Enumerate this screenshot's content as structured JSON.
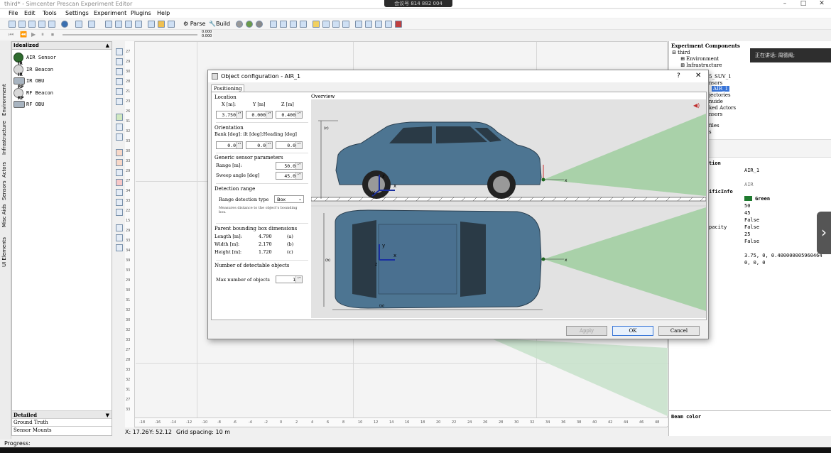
{
  "window": {
    "title": "third* - Simcenter Prescan Experiment Editor",
    "meeting_id": "会议号 814 882 004"
  },
  "menu": [
    "File",
    "Edit",
    "Tools",
    "Settings",
    "Experiment",
    "Plugins",
    "Help"
  ],
  "toolbar": {
    "parse_label": "Parse",
    "build_label": "Build",
    "val1": "0.000",
    "val2": "0.000"
  },
  "left_tabs": [
    "Environment",
    "Infrastructure",
    "Actors",
    "Sensors",
    "Misc Aids",
    "UI Elements"
  ],
  "left_panel": {
    "header": "Idealized",
    "items": [
      {
        "label": "AIR Sensor",
        "sup": ""
      },
      {
        "label": "IR Beacon",
        "sup": "IR"
      },
      {
        "label": "IR OBU",
        "sup": "IR"
      },
      {
        "label": "RF Beacon",
        "sup": "RF"
      },
      {
        "label": "RF OBU",
        "sup": "RF"
      }
    ],
    "bottom_header": "Detailed",
    "bottom_items": [
      "Ground Truth",
      "Sensor Mounts"
    ]
  },
  "canvas": {
    "left_ticks": [
      "27",
      "29",
      "30",
      "28",
      "21",
      "23",
      "26",
      "31",
      "32",
      "33",
      "30",
      "33",
      "29",
      "27",
      "34",
      "33",
      "22",
      "15",
      "29",
      "33",
      "34",
      "39",
      "33",
      "29",
      "30",
      "31",
      "32",
      "30",
      "32",
      "33",
      "27",
      "28",
      "33",
      "32",
      "31",
      "27",
      "33"
    ],
    "bottom_ticks": [
      "-18",
      "-16",
      "-14",
      "-12",
      "-10",
      "-8",
      "-6",
      "-4",
      "-2",
      "0",
      "2",
      "4",
      "6",
      "8",
      "10",
      "12",
      "14",
      "16",
      "18",
      "20",
      "22",
      "24",
      "26",
      "28",
      "30",
      "32",
      "34",
      "36",
      "38",
      "40",
      "42",
      "44",
      "46",
      "48"
    ],
    "status": {
      "x": "X: 17.26",
      "y": "Y: 52.12",
      "grid": "Grid spacing: 10 m"
    }
  },
  "progress_label": "Progress:",
  "right_panel": {
    "header": "Experiment Components",
    "tree": [
      "third",
      "Environment",
      "Infrastructure",
      "",
      "5_SUV_1",
      "nsors",
      "AIR_1",
      "jectories",
      "nuide",
      "ked Actors",
      "nsors",
      "",
      "files",
      "s"
    ],
    "props": [
      {
        "k": "tion",
        "v": "",
        "bold": true
      },
      {
        "k": "",
        "v": "AIR_1",
        "bold": false
      },
      {
        "k": "",
        "v": "AIR",
        "bold": false
      },
      {
        "k": "ificInfo",
        "v": "",
        "bold": true
      },
      {
        "k": "",
        "v": "Green",
        "bold": false
      },
      {
        "k": "",
        "v": "50",
        "bold": false
      },
      {
        "k": "",
        "v": "45",
        "bold": false
      },
      {
        "k": "",
        "v": "False",
        "bold": false
      },
      {
        "k": "",
        "v": "False",
        "bold": false
      },
      {
        "k": "pacity",
        "v": "25",
        "bold": false
      },
      {
        "k": "",
        "v": "False",
        "bold": false
      },
      {
        "k": "",
        "v": "3.75, 0, 0.400000005960464",
        "bold": false
      },
      {
        "k": "",
        "v": "0, 0, 0",
        "bold": false
      }
    ],
    "beam_label": "Beam color"
  },
  "speaking": "正在讲话: 周德阁;",
  "dialog": {
    "title": "Object configuration - AIR_1",
    "tab": "Positioning",
    "location": {
      "title": "Location",
      "x_label": "X [m]:",
      "y_label": "Y [m]",
      "z_label": "Z [m]",
      "x": "3.750",
      "y": "0.000",
      "z": "0.400"
    },
    "orientation": {
      "title": "Orientation",
      "labels": "Bank [deg]: ilt [deg]:Heading [deg]",
      "bank": "0.0",
      "tilt": "0.0",
      "heading": "0.0"
    },
    "generic": {
      "title": "Generic sensor parameters",
      "range_label": "Range [m]:",
      "range": "50.0",
      "sweep_label": "Sweep angle [deg]",
      "sweep": "45.0"
    },
    "detection": {
      "title": "Detection range",
      "type_label": "Range detection type",
      "type_value": "Box",
      "note": "Measures distance to the object's bounding box."
    },
    "bbox": {
      "title": "Parent bounding box dimensions",
      "length_label": "Length [m]:",
      "length": "4.790",
      "length_tag": "(a)",
      "width_label": "Width [m]:",
      "width": "2.170",
      "width_tag": "(b)",
      "height_label": "Height [m]:",
      "height": "1.720",
      "height_tag": "(c)"
    },
    "objects": {
      "title": "Number of detectable objects",
      "max_label": "Max number of objects",
      "max": "1"
    },
    "overview": {
      "title": "Overview",
      "dim_c": "(c)",
      "dim_b": "(b)",
      "dim_a": "(a)",
      "axis_x": "x",
      "axis_y": "y",
      "axis_z": "z"
    },
    "buttons": {
      "apply": "Apply",
      "ok": "OK",
      "cancel": "Cancel"
    }
  }
}
